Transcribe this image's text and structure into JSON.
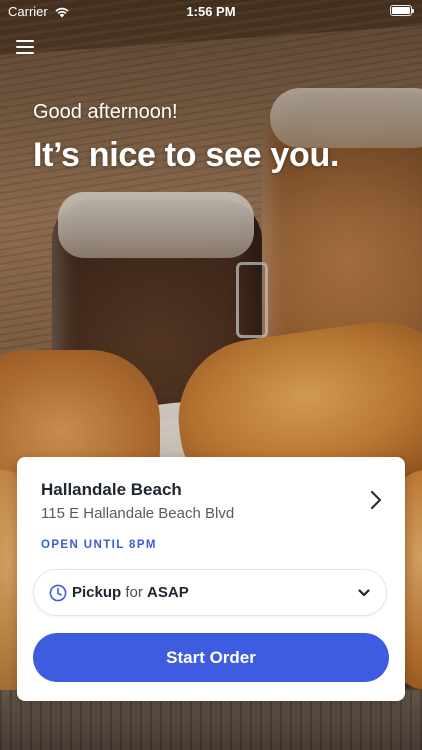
{
  "status_bar": {
    "carrier": "Carrier",
    "time": "1:56 PM",
    "wifi_icon": "wifi-icon",
    "battery_icon": "battery-full-icon"
  },
  "header": {
    "menu_icon": "hamburger-menu-icon"
  },
  "hero": {
    "greeting": "Good afternoon!",
    "headline": "It’s nice to see you."
  },
  "store": {
    "name": "Hallandale Beach",
    "address": "115 E Hallandale Beach Blvd",
    "hours": "OPEN UNTIL 8PM",
    "chevron_icon": "chevron-right-icon"
  },
  "order_mode": {
    "icon": "clock-icon",
    "mode": "Pickup",
    "connector": "for",
    "time": "ASAP",
    "dropdown_icon": "chevron-down-icon"
  },
  "actions": {
    "start_order_label": "Start Order"
  },
  "colors": {
    "accent": "#3e5ce0",
    "hours_text": "#3d5bd9",
    "card_background": "#ffffff",
    "title_text": "#1e2430"
  }
}
